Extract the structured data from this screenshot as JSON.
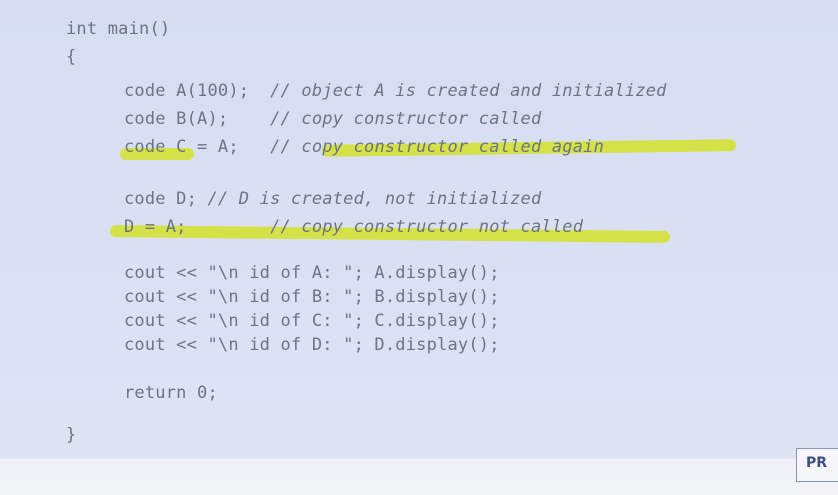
{
  "code_lines": {
    "l1": {
      "code": "int main()",
      "comment": ""
    },
    "l2": {
      "code": "{",
      "comment": ""
    },
    "l3": {
      "code": "code A(100);  ",
      "comment": "// object A is created and initialized"
    },
    "l4": {
      "code": "code B(A);    ",
      "comment": "// copy constructor called"
    },
    "l5": {
      "code": "code C = A;   ",
      "comment": "// copy constructor called again"
    },
    "l6": {
      "code": "code D; ",
      "comment": "// D is created, not initialized"
    },
    "l7": {
      "code": "D = A;        ",
      "comment": "// copy constructor not called"
    },
    "l8": {
      "code": "cout << \"\\n id of A: \"; A.display();",
      "comment": ""
    },
    "l9": {
      "code": "cout << \"\\n id of B: \"; B.display();",
      "comment": ""
    },
    "l10": {
      "code": "cout << \"\\n id of C: \"; C.display();",
      "comment": ""
    },
    "l11": {
      "code": "cout << \"\\n id of D: \"; D.display();",
      "comment": ""
    },
    "l12": {
      "code": "return 0;",
      "comment": ""
    },
    "l13": {
      "code": "}",
      "comment": ""
    }
  },
  "highlight_color": "#d4e23a",
  "nav": {
    "pr_label": "PR"
  }
}
